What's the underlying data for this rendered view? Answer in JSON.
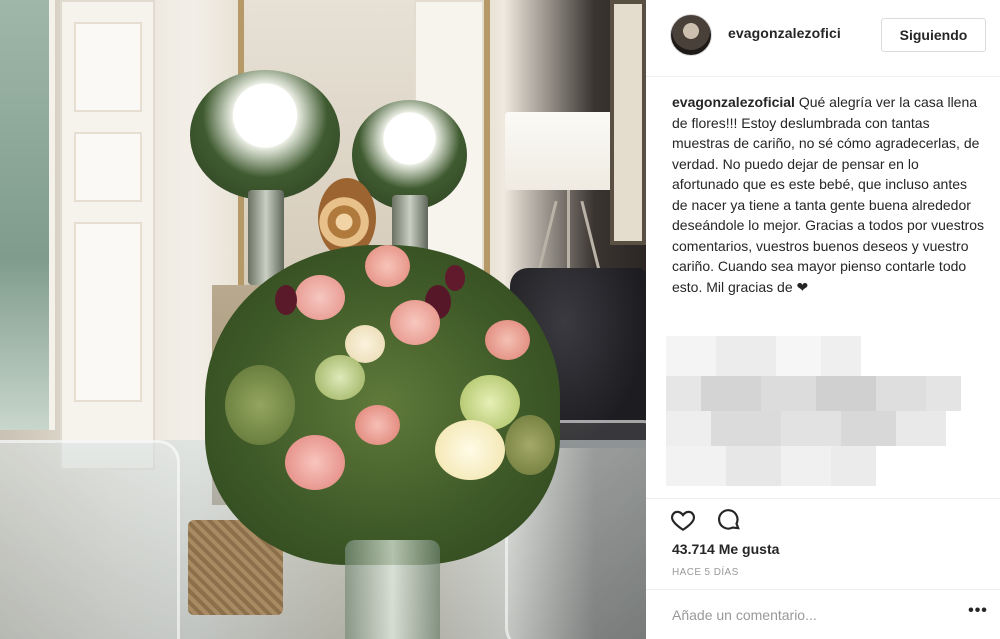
{
  "post": {
    "author": {
      "username": "evagonzalezofici",
      "follow_label": "Siguiendo"
    },
    "caption": {
      "username": "evagonzalezoficial",
      "text": "Qué alegría ver la casa llena de flores!!! Estoy deslumbrada con tantas muestras de cariño, no sé cómo agradecerlas, de verdad. No puedo dejar de pensar en lo afortunado que es este bebé, que incluso antes de nacer ya tiene a tanta gente buena alrededor deseándole lo mejor. Gracias a todos por vuestros comentarios, vuestros buenos deseos y vuestro cariño. Cuando sea mayor pienso contarle todo esto. Mil gracias de ❤"
    },
    "actions": {
      "like_icon": "heart-outline-icon",
      "comment_icon": "speech-bubble-icon"
    },
    "likes": "43.714 Me gusta",
    "posted": "HACE 5 DÍAS",
    "comment_placeholder": "Añade un comentario...",
    "more_options": "•••"
  },
  "colors": {
    "text": "#262626",
    "muted": "#999999",
    "border": "#dbdbdb",
    "divider": "#efefef"
  }
}
